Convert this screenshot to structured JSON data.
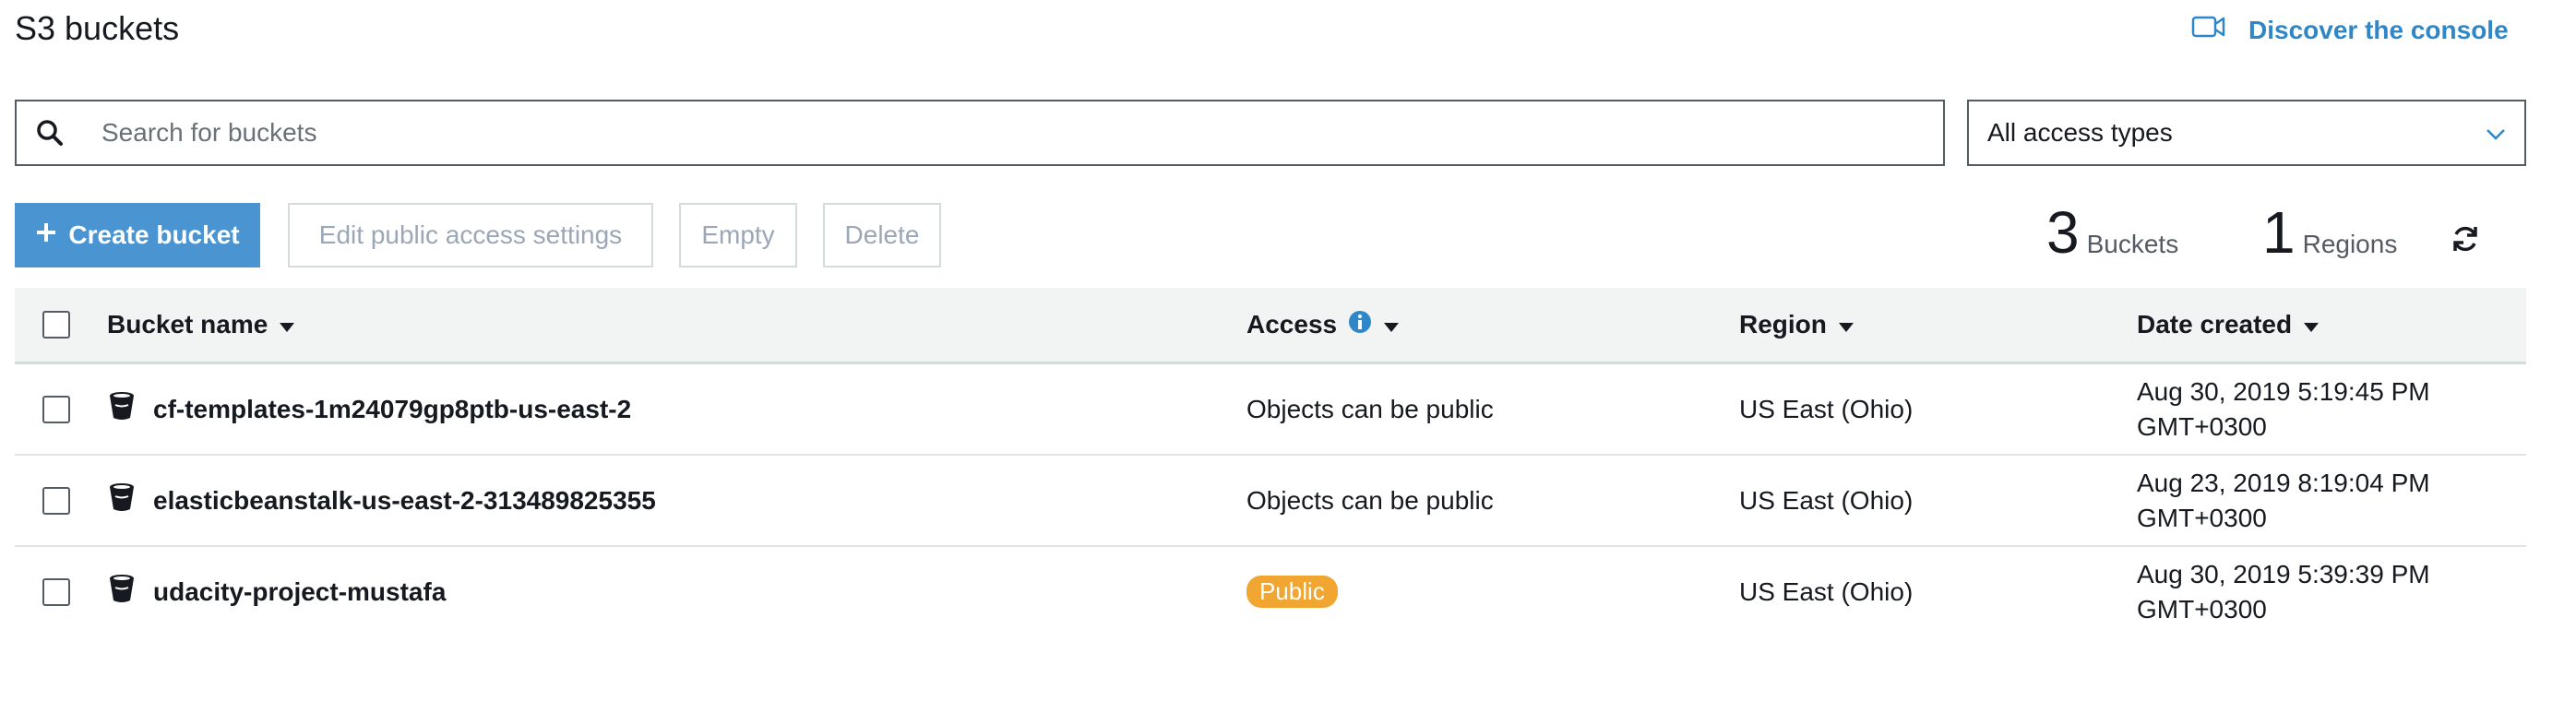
{
  "header": {
    "title": "S3 buckets",
    "discover_label": "Discover the console"
  },
  "search": {
    "placeholder": "Search for buckets",
    "value": ""
  },
  "filter": {
    "selected": "All access types"
  },
  "toolbar": {
    "create_label": "Create bucket",
    "edit_label": "Edit public access settings",
    "empty_label": "Empty",
    "delete_label": "Delete"
  },
  "summary": {
    "buckets_count": "3",
    "buckets_label": "Buckets",
    "regions_count": "1",
    "regions_label": "Regions"
  },
  "table": {
    "columns": {
      "name": "Bucket name",
      "access": "Access",
      "region": "Region",
      "date": "Date created"
    },
    "rows": [
      {
        "name": "cf-templates-1m24079gp8ptb-us-east-2",
        "access": "Objects can be public",
        "region": "US East (Ohio)",
        "date_line1": "Aug 30, 2019 5:19:45 PM",
        "date_line2": "GMT+0300"
      },
      {
        "name": "elasticbeanstalk-us-east-2-313489825355",
        "access": "Objects can be public",
        "region": "US East (Ohio)",
        "date_line1": "Aug 23, 2019 8:19:04 PM",
        "date_line2": "GMT+0300"
      },
      {
        "name": "udacity-project-mustafa",
        "access": "Public",
        "region": "US East (Ohio)",
        "date_line1": "Aug 30, 2019 5:39:39 PM",
        "date_line2": "GMT+0300"
      }
    ]
  },
  "colors": {
    "accent": "#4a94d1",
    "link": "#2f87c8",
    "public_badge": "#f0a630"
  },
  "icons": [
    "video-icon",
    "search-icon",
    "chevron-down-icon",
    "plus-icon",
    "refresh-icon",
    "info-icon",
    "caret-down-icon",
    "bucket-icon"
  ]
}
